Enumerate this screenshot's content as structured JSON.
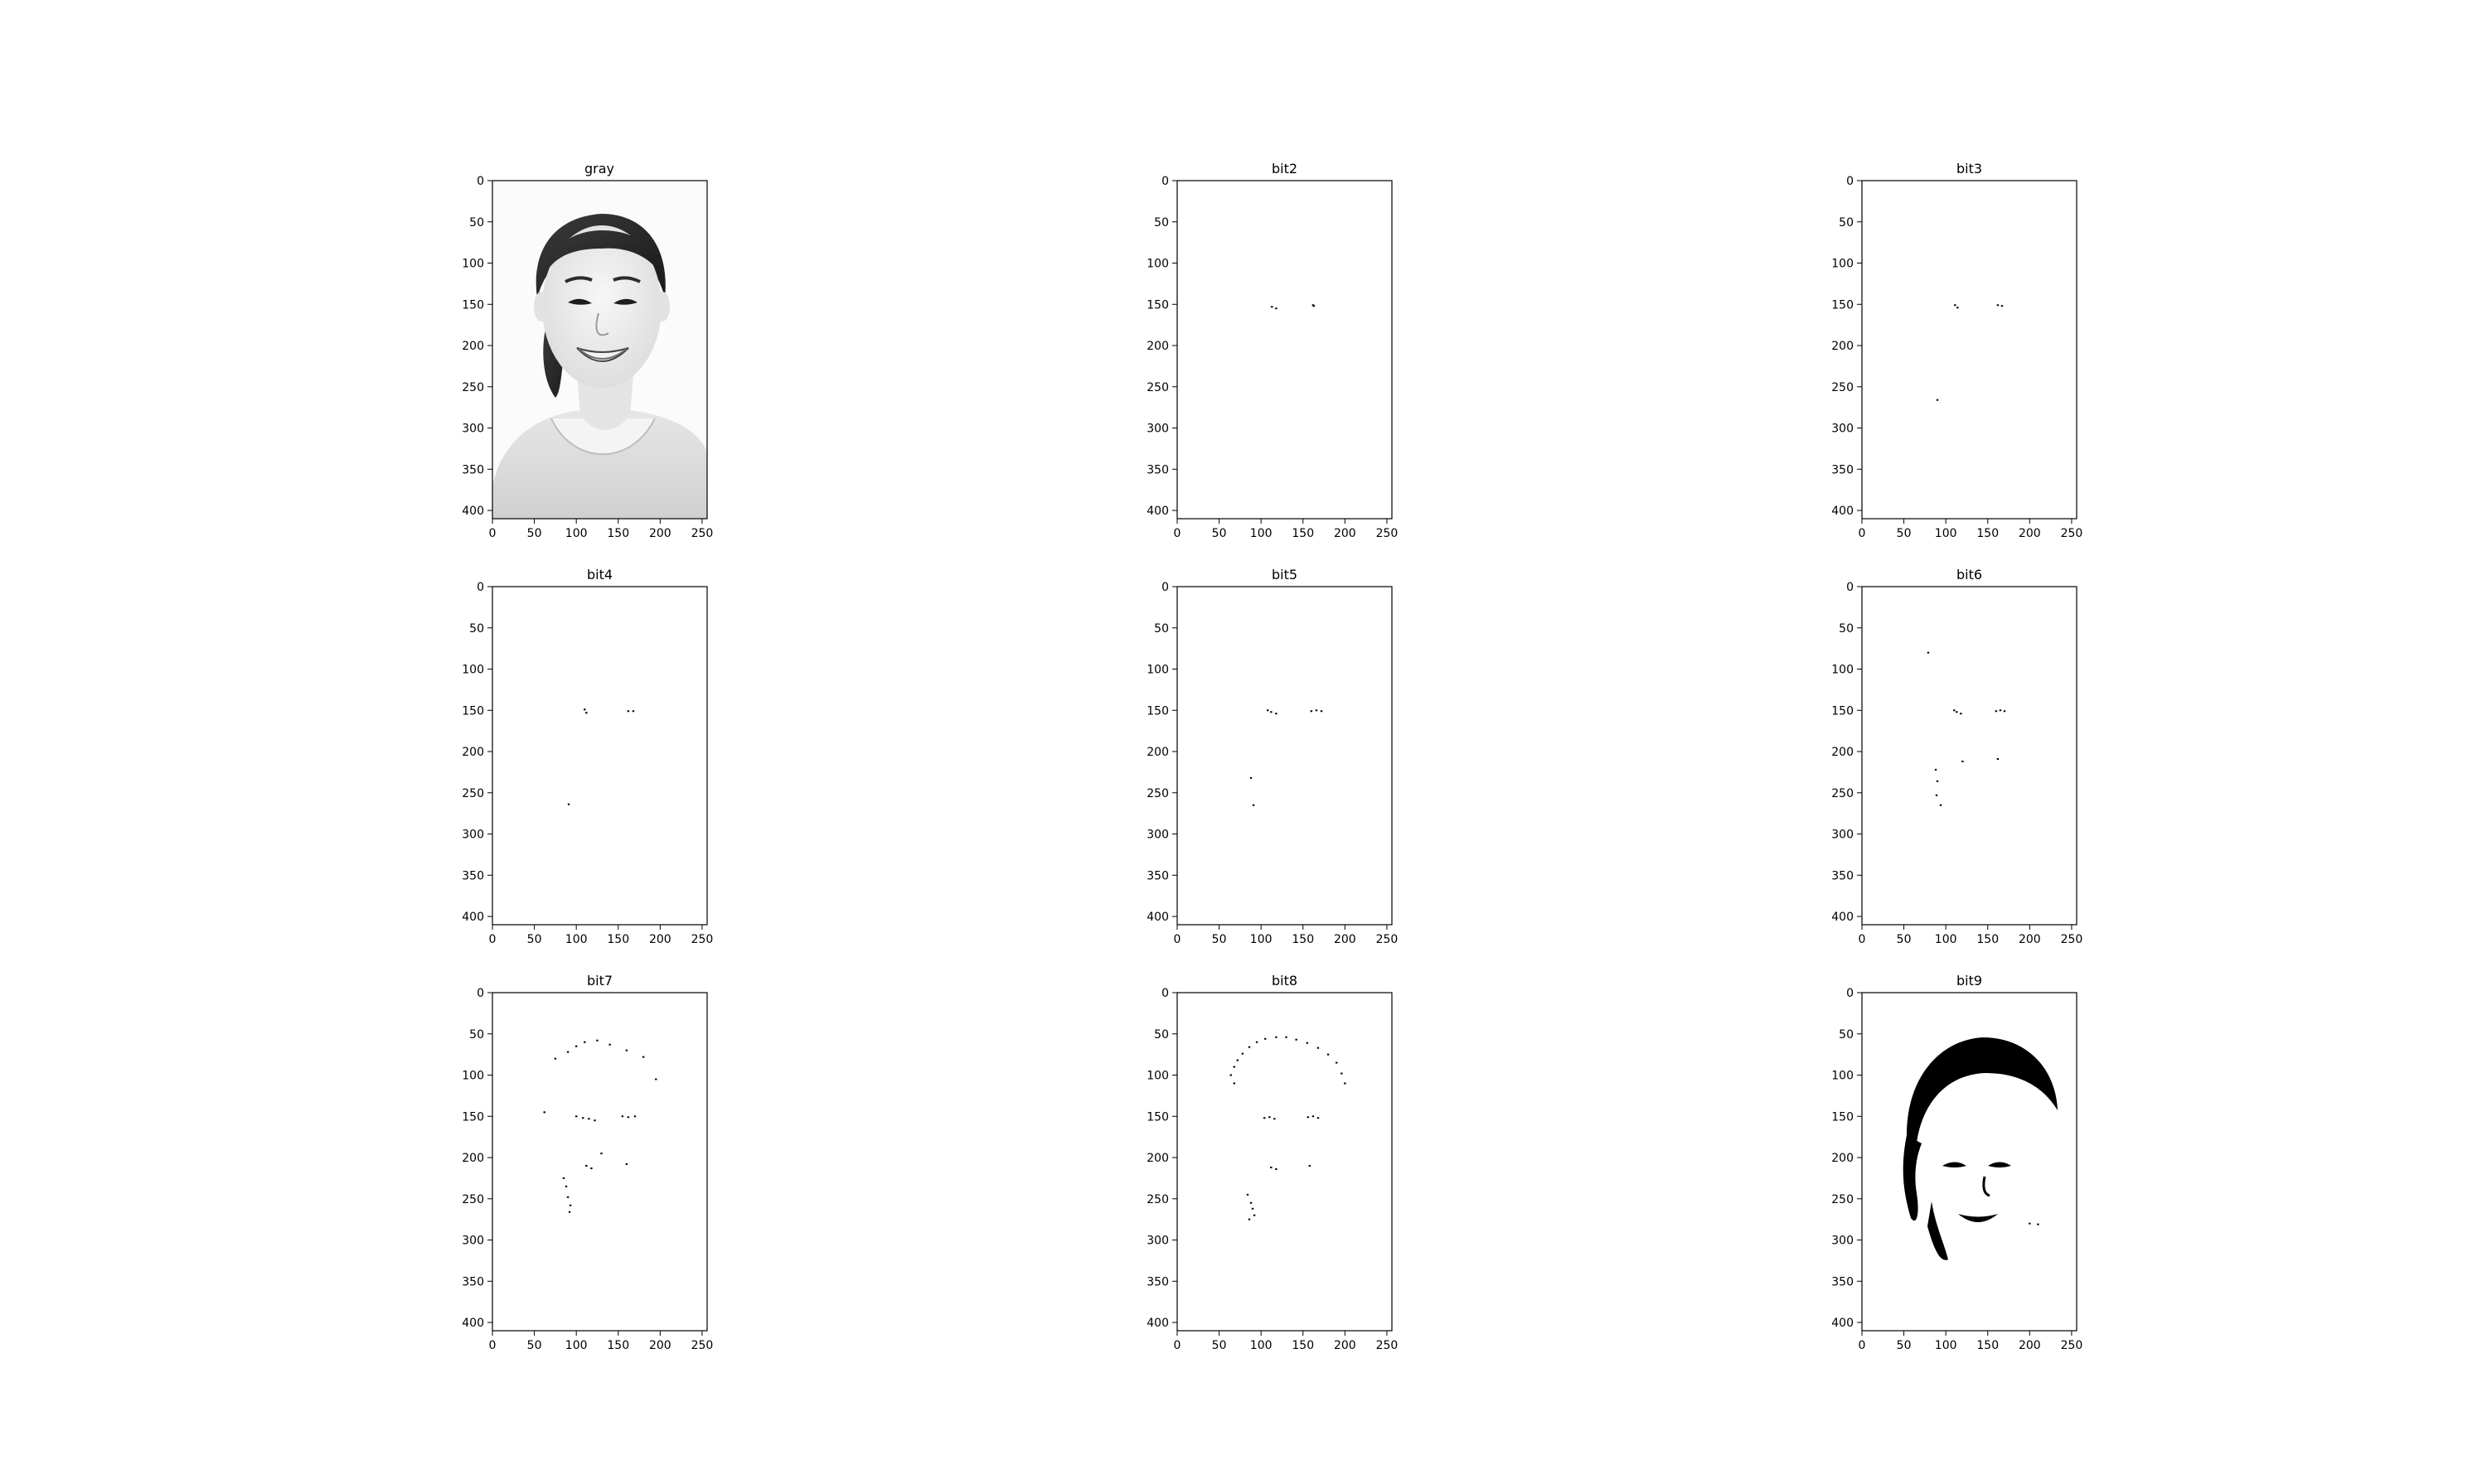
{
  "figure": {
    "background": "#ffffff",
    "axis_color": "#000000",
    "pixel_color": "#000000",
    "grid": false
  },
  "chart_data": [
    {
      "type": "image",
      "title": "gray",
      "content": "grayscale portrait photo of a smiling woman",
      "xlim": [
        0,
        256
      ],
      "ylim": [
        410,
        0
      ],
      "xticks": [
        0,
        50,
        100,
        150,
        200,
        250
      ],
      "yticks": [
        0,
        50,
        100,
        150,
        200,
        250,
        300,
        350,
        400
      ]
    },
    {
      "type": "image",
      "title": "bit2",
      "xlim": [
        0,
        256
      ],
      "ylim": [
        410,
        0
      ],
      "xticks": [
        0,
        50,
        100,
        150,
        200,
        250
      ],
      "yticks": [
        0,
        50,
        100,
        150,
        200,
        250,
        300,
        350,
        400
      ],
      "dark_points": [
        [
          113,
          153
        ],
        [
          118,
          155
        ],
        [
          162,
          151
        ],
        [
          163,
          152
        ]
      ]
    },
    {
      "type": "image",
      "title": "bit3",
      "xlim": [
        0,
        256
      ],
      "ylim": [
        410,
        0
      ],
      "xticks": [
        0,
        50,
        100,
        150,
        200,
        250
      ],
      "yticks": [
        0,
        50,
        100,
        150,
        200,
        250,
        300,
        350,
        400
      ],
      "dark_points": [
        [
          111,
          151
        ],
        [
          114,
          154
        ],
        [
          162,
          151
        ],
        [
          167,
          152
        ],
        [
          90,
          266
        ]
      ]
    },
    {
      "type": "image",
      "title": "bit4",
      "xlim": [
        0,
        256
      ],
      "ylim": [
        410,
        0
      ],
      "xticks": [
        0,
        50,
        100,
        150,
        200,
        250
      ],
      "yticks": [
        0,
        50,
        100,
        150,
        200,
        250,
        300,
        350,
        400
      ],
      "dark_points": [
        [
          110,
          149
        ],
        [
          112,
          153
        ],
        [
          162,
          151
        ],
        [
          168,
          151
        ],
        [
          91,
          264
        ]
      ]
    },
    {
      "type": "image",
      "title": "bit5",
      "xlim": [
        0,
        256
      ],
      "ylim": [
        410,
        0
      ],
      "xticks": [
        0,
        50,
        100,
        150,
        200,
        250
      ],
      "yticks": [
        0,
        50,
        100,
        150,
        200,
        250,
        300,
        350,
        400
      ],
      "dark_points": [
        [
          108,
          150
        ],
        [
          112,
          152
        ],
        [
          118,
          154
        ],
        [
          160,
          151
        ],
        [
          166,
          150
        ],
        [
          172,
          151
        ],
        [
          88,
          232
        ],
        [
          91,
          265
        ]
      ]
    },
    {
      "type": "image",
      "title": "bit6",
      "xlim": [
        0,
        256
      ],
      "ylim": [
        410,
        0
      ],
      "xticks": [
        0,
        50,
        100,
        150,
        200,
        250
      ],
      "yticks": [
        0,
        50,
        100,
        150,
        200,
        250,
        300,
        350,
        400
      ],
      "dark_points": [
        [
          79,
          80
        ],
        [
          110,
          150
        ],
        [
          113,
          152
        ],
        [
          118,
          154
        ],
        [
          160,
          151
        ],
        [
          165,
          150
        ],
        [
          170,
          151
        ],
        [
          120,
          212
        ],
        [
          162,
          209
        ],
        [
          88,
          222
        ],
        [
          90,
          236
        ],
        [
          89,
          253
        ],
        [
          94,
          265
        ]
      ]
    },
    {
      "type": "image",
      "title": "bit7",
      "xlim": [
        0,
        256
      ],
      "ylim": [
        410,
        0
      ],
      "xticks": [
        0,
        50,
        100,
        150,
        200,
        250
      ],
      "yticks": [
        0,
        50,
        100,
        150,
        200,
        250,
        300,
        350,
        400
      ],
      "dark_points": [
        [
          75,
          80
        ],
        [
          90,
          72
        ],
        [
          100,
          65
        ],
        [
          110,
          60
        ],
        [
          125,
          58
        ],
        [
          140,
          63
        ],
        [
          160,
          70
        ],
        [
          180,
          78
        ],
        [
          195,
          105
        ],
        [
          62,
          145
        ],
        [
          100,
          150
        ],
        [
          108,
          152
        ],
        [
          115,
          153
        ],
        [
          122,
          155
        ],
        [
          155,
          150
        ],
        [
          162,
          151
        ],
        [
          170,
          150
        ],
        [
          112,
          210
        ],
        [
          118,
          213
        ],
        [
          160,
          208
        ],
        [
          130,
          195
        ],
        [
          85,
          225
        ],
        [
          88,
          235
        ],
        [
          90,
          248
        ],
        [
          93,
          258
        ],
        [
          92,
          266
        ]
      ]
    },
    {
      "type": "image",
      "title": "bit8",
      "xlim": [
        0,
        256
      ],
      "ylim": [
        410,
        0
      ],
      "xticks": [
        0,
        50,
        100,
        150,
        200,
        250
      ],
      "yticks": [
        0,
        50,
        100,
        150,
        200,
        250,
        300,
        350,
        400
      ],
      "dark_points": [
        [
          68,
          90
        ],
        [
          72,
          82
        ],
        [
          78,
          74
        ],
        [
          86,
          66
        ],
        [
          95,
          60
        ],
        [
          105,
          56
        ],
        [
          118,
          54
        ],
        [
          130,
          54
        ],
        [
          142,
          57
        ],
        [
          155,
          61
        ],
        [
          168,
          67
        ],
        [
          180,
          75
        ],
        [
          190,
          85
        ],
        [
          196,
          98
        ],
        [
          64,
          100
        ],
        [
          68,
          110
        ],
        [
          200,
          110
        ],
        [
          104,
          152
        ],
        [
          110,
          151
        ],
        [
          116,
          153
        ],
        [
          156,
          151
        ],
        [
          162,
          150
        ],
        [
          168,
          152
        ],
        [
          112,
          212
        ],
        [
          118,
          214
        ],
        [
          158,
          210
        ],
        [
          84,
          245
        ],
        [
          88,
          255
        ],
        [
          90,
          262
        ],
        [
          92,
          270
        ],
        [
          86,
          275
        ]
      ]
    },
    {
      "type": "image",
      "title": "bit9",
      "content": "thresholded silhouette: dark hair, eyes, mouth and left-side shading",
      "xlim": [
        0,
        256
      ],
      "ylim": [
        410,
        0
      ],
      "xticks": [
        0,
        50,
        100,
        150,
        200,
        250
      ],
      "yticks": [
        0,
        50,
        100,
        150,
        200,
        250,
        300,
        350,
        400
      ],
      "dark_points": [
        [
          200,
          280
        ],
        [
          210,
          281
        ]
      ]
    }
  ]
}
